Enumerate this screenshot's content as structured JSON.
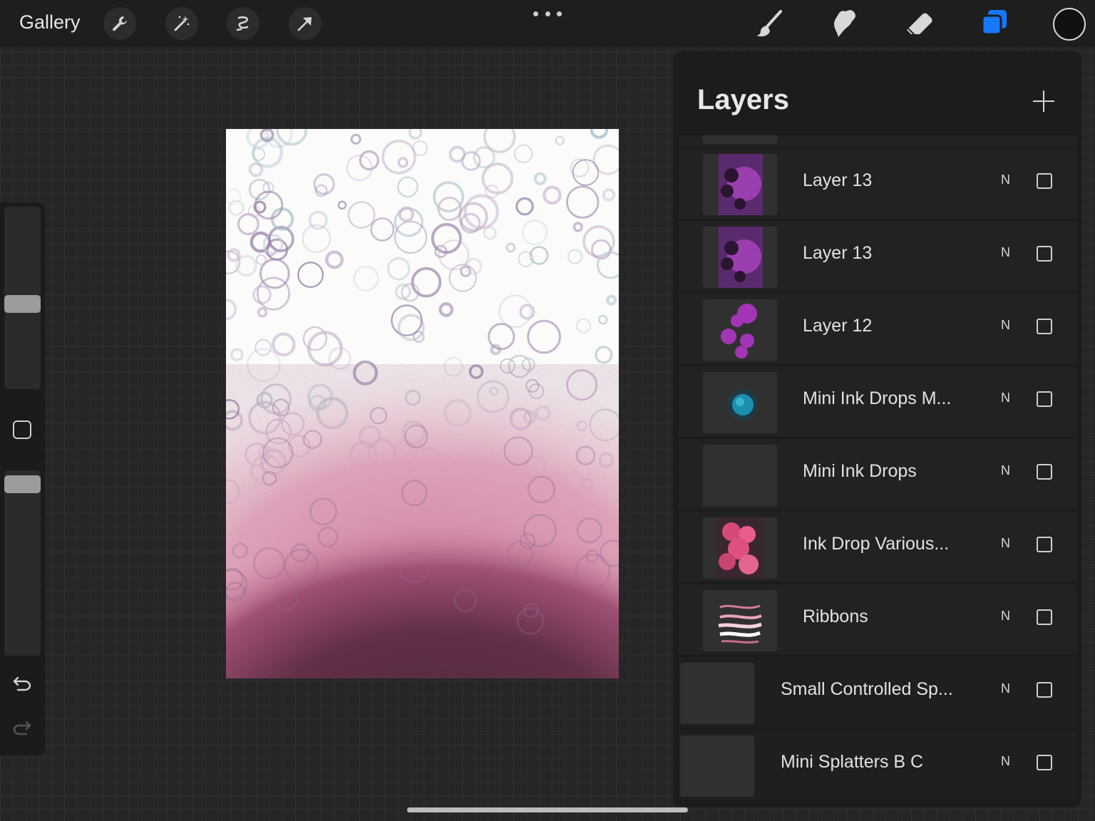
{
  "topbar": {
    "gallery_label": "Gallery",
    "left_tools": [
      "wrench-icon",
      "magic-wand-icon",
      "selection-icon",
      "transform-arrow-icon"
    ],
    "right_tools": [
      "brush-icon",
      "smudge-icon",
      "eraser-icon",
      "layers-icon"
    ],
    "active_tool": "layers-icon",
    "accent_color": "#1677ff",
    "current_color": "#111111"
  },
  "layers_panel": {
    "title": "Layers",
    "add_icon": "plus-icon",
    "layers": [
      {
        "name": "Layer 13",
        "blend": "N",
        "thumb": "purple-circle"
      },
      {
        "name": "Layer 13",
        "blend": "N",
        "thumb": "purple-circle"
      },
      {
        "name": "Layer 12",
        "blend": "N",
        "thumb": "purple-dots"
      },
      {
        "name": "Mini Ink Drops M...",
        "blend": "N",
        "thumb": "teal-drop"
      },
      {
        "name": "Mini Ink Drops",
        "blend": "N",
        "thumb": "empty"
      },
      {
        "name": "Ink Drop Various...",
        "blend": "N",
        "thumb": "pink-drops"
      },
      {
        "name": "Ribbons",
        "blend": "N",
        "thumb": "ribbons"
      },
      {
        "name": "Small Controlled Sp...",
        "blend": "N",
        "thumb": "empty"
      },
      {
        "name": "Mini Splatters B C",
        "blend": "N",
        "thumb": "empty"
      }
    ]
  },
  "sidebar": {
    "brush_size_icon": "size-slider",
    "modify_icon": "square-icon",
    "opacity_icon": "opacity-slider",
    "undo_icon": "undo-icon",
    "redo_icon": "redo-icon"
  }
}
